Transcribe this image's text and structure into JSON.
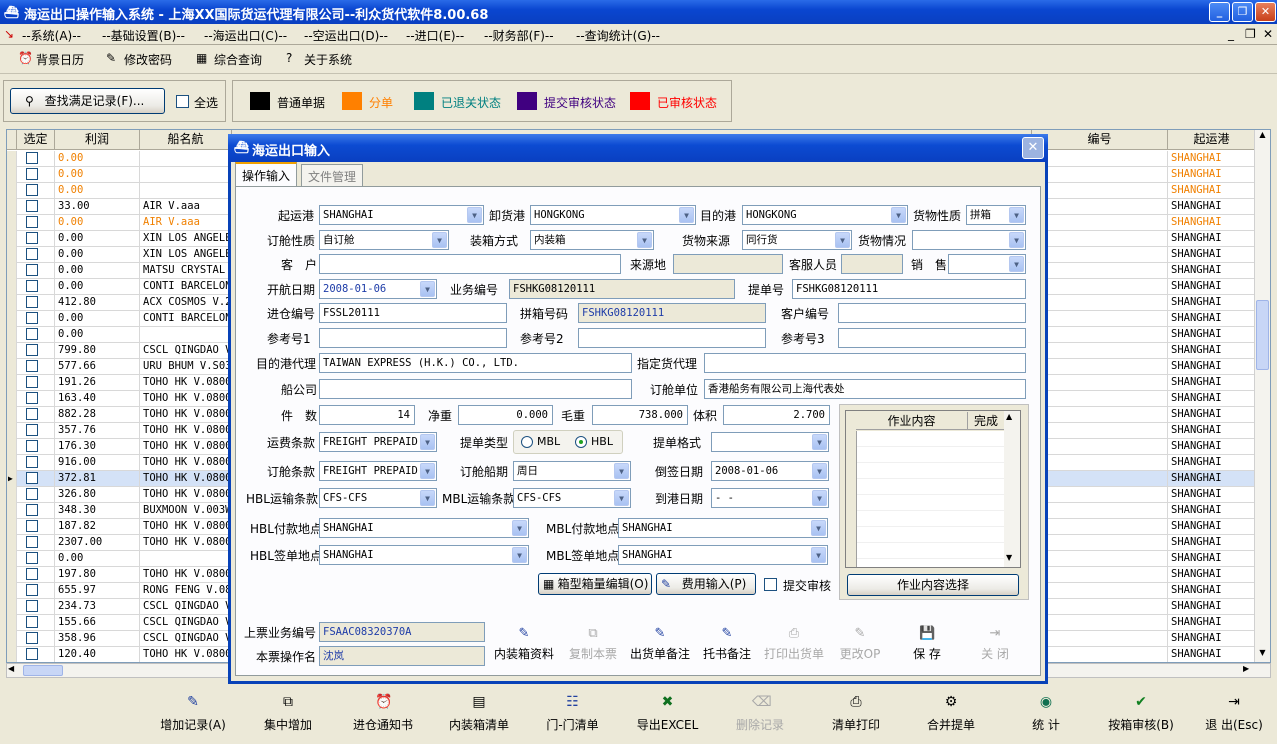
{
  "window": {
    "title": "海运出口操作输入系统 - 上海XX国际货运代理有限公司--利众货代软件8.00.68"
  },
  "menu": [
    "--系统(A)--",
    "--基础设置(B)--",
    "--海运出口(C)--",
    "--空运出口(D)--",
    "--进口(E)--",
    "--财务部(F)--",
    "--查询统计(G)--"
  ],
  "toolbar": {
    "items": [
      "背景日历",
      "修改密码",
      "综合查询",
      "关于系统"
    ]
  },
  "filter": {
    "find_label": "查找满足记录(F)...",
    "select_all": "全选"
  },
  "legend": [
    {
      "label": "普通单据",
      "color": "#000000",
      "text_color": "#000000"
    },
    {
      "label": "分单",
      "color": "#FF8000",
      "text_color": "#FF8000"
    },
    {
      "label": "已退关状态",
      "color": "#008080",
      "text_color": "#008080"
    },
    {
      "label": "提交审核状态",
      "color": "#400080",
      "text_color": "#400080"
    },
    {
      "label": "已审核状态",
      "color": "#FF0000",
      "text_color": "#FF0000"
    }
  ],
  "grid": {
    "headers": {
      "select": "选定",
      "profit": "利润",
      "ship": "船名航",
      "number": "编号",
      "origin": "起运港"
    },
    "rows": [
      {
        "profit": "0.00",
        "ship": "",
        "origin": "SHANGHAI",
        "orange": true
      },
      {
        "profit": "0.00",
        "ship": "",
        "origin": "SHANGHAI",
        "orange": true
      },
      {
        "profit": "0.00",
        "ship": "",
        "origin": "SHANGHAI",
        "orange": true
      },
      {
        "profit": "33.00",
        "ship": "AIR V.aaa",
        "origin": "SHANGHAI",
        "orange": false
      },
      {
        "profit": "0.00",
        "ship": "AIR V.aaa",
        "origin": "SHANGHAI",
        "orange": true
      },
      {
        "profit": "0.00",
        "ship": "XIN LOS ANGELE",
        "origin": "SHANGHAI",
        "orange": false
      },
      {
        "profit": "0.00",
        "ship": "XIN LOS ANGELE",
        "origin": "SHANGHAI",
        "orange": false
      },
      {
        "profit": "0.00",
        "ship": "MATSU CRYSTAL",
        "origin": "SHANGHAI",
        "orange": false
      },
      {
        "profit": "0.00",
        "ship": "CONTI BARCELON",
        "origin": "SHANGHAI",
        "orange": false
      },
      {
        "profit": "412.80",
        "ship": "ACX COSMOS V.2",
        "origin": "SHANGHAI",
        "orange": false
      },
      {
        "profit": "0.00",
        "ship": "CONTI BARCELON",
        "origin": "SHANGHAI",
        "orange": false
      },
      {
        "profit": "0.00",
        "ship": "",
        "origin": "SHANGHAI",
        "orange": false
      },
      {
        "profit": "799.80",
        "ship": "CSCL QINGDAO V",
        "origin": "SHANGHAI",
        "orange": false
      },
      {
        "profit": "577.66",
        "ship": "URU BHUM V.S03",
        "origin": "SHANGHAI",
        "orange": false
      },
      {
        "profit": "191.26",
        "ship": "TOHO HK V.0800",
        "origin": "SHANGHAI",
        "orange": false
      },
      {
        "profit": "163.40",
        "ship": "TOHO HK V.0800",
        "origin": "SHANGHAI",
        "orange": false
      },
      {
        "profit": "882.28",
        "ship": "TOHO HK V.0800",
        "origin": "SHANGHAI",
        "orange": false
      },
      {
        "profit": "357.76",
        "ship": "TOHO HK V.0800",
        "origin": "SHANGHAI",
        "orange": false
      },
      {
        "profit": "176.30",
        "ship": "TOHO HK V.0800",
        "origin": "SHANGHAI",
        "orange": false
      },
      {
        "profit": "916.00",
        "ship": "TOHO HK V.0800",
        "origin": "SHANGHAI",
        "orange": false
      },
      {
        "profit": "372.81",
        "ship": "TOHO HK V.0800",
        "origin": "SHANGHAI",
        "orange": false
      },
      {
        "profit": "326.80",
        "ship": "TOHO HK V.0800",
        "origin": "SHANGHAI",
        "orange": false
      },
      {
        "profit": "348.30",
        "ship": "BUXMOON V.003W",
        "origin": "SHANGHAI",
        "orange": false
      },
      {
        "profit": "187.82",
        "ship": "TOHO HK V.0800",
        "origin": "SHANGHAI",
        "orange": false
      },
      {
        "profit": "2307.00",
        "ship": "TOHO HK V.0800",
        "origin": "SHANGHAI",
        "orange": false
      },
      {
        "profit": "0.00",
        "ship": "",
        "origin": "SHANGHAI",
        "orange": false
      },
      {
        "profit": "197.80",
        "ship": "TOHO HK V.0800",
        "origin": "SHANGHAI",
        "orange": false
      },
      {
        "profit": "655.97",
        "ship": "RONG FENG V.08",
        "origin": "SHANGHAI",
        "orange": false
      },
      {
        "profit": "234.73",
        "ship": "CSCL QINGDAO V",
        "origin": "SHANGHAI",
        "orange": false
      },
      {
        "profit": "155.66",
        "ship": "CSCL QINGDAO V",
        "origin": "SHANGHAI",
        "orange": false
      },
      {
        "profit": "358.96",
        "ship": "CSCL QINGDAO V",
        "origin": "SHANGHAI",
        "orange": false
      },
      {
        "profit": "120.40",
        "ship": "TOHO HK V.0800",
        "origin": "SHANGHAI",
        "orange": false
      }
    ]
  },
  "bottom_toolbar": [
    "增加记录(A)",
    "集中增加",
    "进仓通知书",
    "内装箱清单",
    "门-门清单",
    "导出EXCEL",
    "删除记录",
    "清单打印",
    "合并提单",
    "统 计",
    "按箱审核(B)",
    "退 出(Esc)"
  ],
  "dialog": {
    "title": "海运出口输入",
    "tabs": [
      "操作输入",
      "文件管理"
    ],
    "labels": {
      "origin_port": "起运港",
      "discharge_port": "卸货港",
      "dest_port": "目的港",
      "cargo_nature": "货物性质",
      "booking_nature": "订舱性质",
      "packing": "装箱方式",
      "cargo_source": "货物来源",
      "cargo_status": "货物情况",
      "customer": "客　户",
      "source": "来源地",
      "cs_staff": "客服人员",
      "sales": "销　售",
      "sail_date": "开航日期",
      "business_no": "业务编号",
      "bl_no": "提单号",
      "warehouse_no": "进仓编号",
      "consol_no": "拼箱号码",
      "customer_no": "客户编号",
      "ref1": "参考号1",
      "ref2": "参考号2",
      "ref3": "参考号3",
      "dest_agent": "目的港代理",
      "designated_agent": "指定货代理",
      "carrier": "船公司",
      "booking_party": "订舱单位",
      "pieces": "件　数",
      "net_weight": "净重",
      "gross_weight": "毛重",
      "volume": "体积",
      "freight_terms": "运费条款",
      "bl_type": "提单类型",
      "bl_format": "提单格式",
      "booking_terms": "订舱条款",
      "booking_sailing": "订舱船期",
      "backdate": "倒签日期",
      "hbl_transport": "HBL运输条款",
      "mbl_transport": "MBL运输条款",
      "arrival_date": "到港日期",
      "hbl_pay_place": "HBL付款地点",
      "mbl_pay_place": "MBL付款地点",
      "hbl_issue_place": "HBL签单地点",
      "mbl_issue_place": "MBL签单地点",
      "prev_business_no": "上票业务编号",
      "operator_name": "本票操作名"
    },
    "values": {
      "origin_port": "SHANGHAI",
      "discharge_port": "HONGKONG",
      "dest_port": "HONGKONG",
      "cargo_nature": "拼箱",
      "booking_nature": "自订舱",
      "packing": "内装箱",
      "cargo_source": "同行货",
      "cargo_status": "",
      "customer": "",
      "source": "",
      "cs_staff": "",
      "sales": "",
      "sail_date": "2008-01-06",
      "business_no": "FSHKG08120111",
      "bl_no": "FSHKG08120111",
      "warehouse_no": "FSSL20111",
      "consol_no": "FSHKG08120111",
      "customer_no": "",
      "ref1": "",
      "ref2": "",
      "ref3": "",
      "dest_agent": "TAIWAN EXPRESS (H.K.) CO., LTD.",
      "designated_agent": "",
      "carrier": "",
      "booking_party": "香港船务有限公司上海代表处",
      "pieces": "14",
      "net_weight": "0.000",
      "gross_weight": "738.000",
      "volume": "2.700",
      "freight_terms": "FREIGHT PREPAID",
      "bl_format": "",
      "booking_terms": "FREIGHT PREPAID",
      "booking_sailing": "周日",
      "backdate": "2008-01-06",
      "hbl_transport": "CFS-CFS",
      "mbl_transport": "CFS-CFS",
      "arrival_date": "  -  -",
      "hbl_pay_place": "SHANGHAI",
      "mbl_pay_place": "SHANGHAI",
      "hbl_issue_place": "SHANGHAI",
      "mbl_issue_place": "SHANGHAI",
      "prev_business_no": "FSAAC08320370A",
      "operator_name": "沈岚"
    },
    "bl_type_options": [
      "MBL",
      "HBL"
    ],
    "bl_type_selected": "HBL",
    "container_edit": "箱型箱量编辑(O)",
    "fee_input": "费用输入(P)",
    "submit_review": "提交审核",
    "work_table": {
      "col_content": "作业内容",
      "col_done": "完成"
    },
    "work_select": "作业内容选择",
    "actions": [
      "内装箱资料",
      "复制本票",
      "出货单备注",
      "托书备注",
      "打印出货单",
      "更改OP",
      "保 存",
      "关 闭"
    ]
  }
}
